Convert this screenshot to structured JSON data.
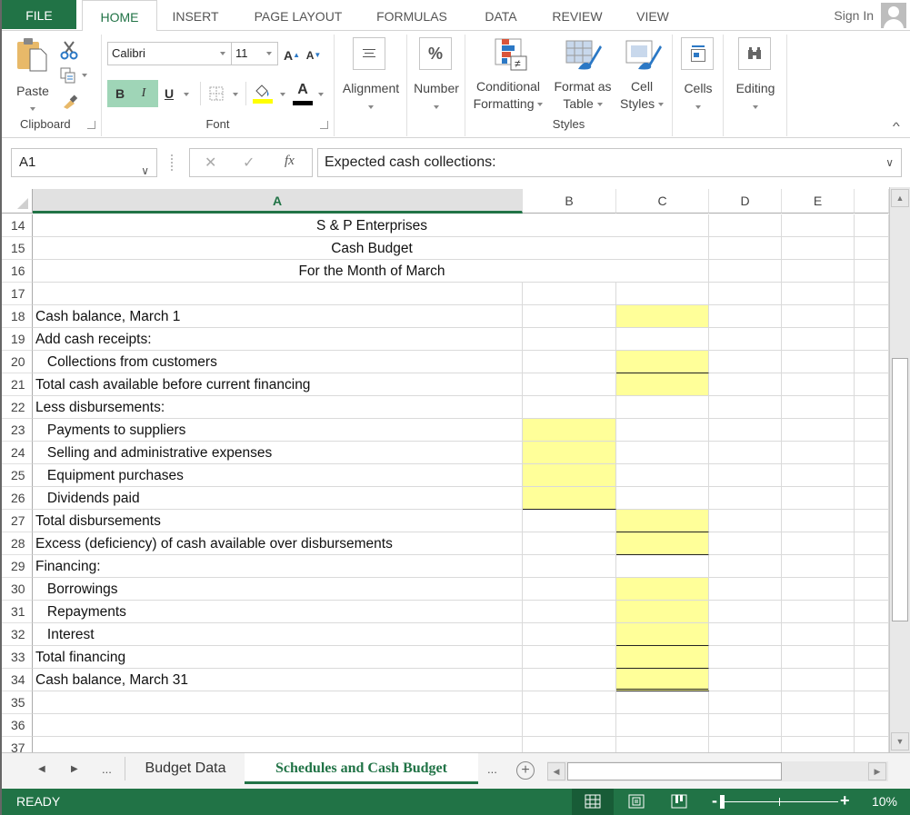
{
  "ribbon_tabs": [
    {
      "label": "FILE"
    },
    {
      "label": "HOME"
    },
    {
      "label": "INSERT"
    },
    {
      "label": "PAGE LAYOUT"
    },
    {
      "label": "FORMULAS"
    },
    {
      "label": "DATA"
    },
    {
      "label": "REVIEW"
    },
    {
      "label": "VIEW"
    }
  ],
  "active_tab": "HOME",
  "sign_in": "Sign In",
  "ribbon": {
    "clipboard": {
      "group_label": "Clipboard",
      "paste_label": "Paste"
    },
    "font": {
      "group_label": "Font",
      "font_name": "Calibri",
      "font_size": "11",
      "bold": "B",
      "italic": "I",
      "underline": "U",
      "grow": "A",
      "shrink": "A",
      "font_color": "A"
    },
    "alignment": {
      "label": "Alignment"
    },
    "number": {
      "label": "Number",
      "icon_text": "%"
    },
    "styles": {
      "group_label": "Styles",
      "conditional_1": "Conditional",
      "conditional_2": "Formatting",
      "format_table_1": "Format as",
      "format_table_2": "Table",
      "cell_styles_1": "Cell",
      "cell_styles_2": "Styles"
    },
    "cells": {
      "label": "Cells"
    },
    "editing": {
      "label": "Editing"
    }
  },
  "formula_bar": {
    "name_box": "A1",
    "cancel": "✕",
    "enter": "✓",
    "fx": "fx",
    "content": "Expected cash collections:"
  },
  "columns": [
    "A",
    "B",
    "C",
    "D",
    "E"
  ],
  "selected_column": "A",
  "rows": [
    {
      "num": "14",
      "a": "S & P Enterprises",
      "center": true
    },
    {
      "num": "15",
      "a": "Cash Budget",
      "center": true
    },
    {
      "num": "16",
      "a": "For the Month of March",
      "center": true
    },
    {
      "num": "17",
      "a": ""
    },
    {
      "num": "18",
      "a": "Cash balance, March 1"
    },
    {
      "num": "19",
      "a": "Add cash receipts:"
    },
    {
      "num": "20",
      "a": "   Collections from customers"
    },
    {
      "num": "21",
      "a": "Total cash available before current financing"
    },
    {
      "num": "22",
      "a": "Less disbursements:"
    },
    {
      "num": "23",
      "a": "   Payments to suppliers"
    },
    {
      "num": "24",
      "a": "   Selling and administrative expenses"
    },
    {
      "num": "25",
      "a": "   Equipment purchases"
    },
    {
      "num": "26",
      "a": "   Dividends paid"
    },
    {
      "num": "27",
      "a": "Total disbursements"
    },
    {
      "num": "28",
      "a": "Excess (deficiency) of cash available over disbursements"
    },
    {
      "num": "29",
      "a": "Financing:"
    },
    {
      "num": "30",
      "a": "   Borrowings"
    },
    {
      "num": "31",
      "a": "   Repayments"
    },
    {
      "num": "32",
      "a": "   Interest"
    },
    {
      "num": "33",
      "a": "Total financing"
    },
    {
      "num": "34",
      "a": "Cash balance, March 31"
    },
    {
      "num": "35",
      "a": ""
    },
    {
      "num": "36",
      "a": ""
    },
    {
      "num": "37",
      "a": ""
    }
  ],
  "input_cells": {
    "B": [
      "23",
      "24",
      "25",
      "26"
    ],
    "C": [
      "18",
      "20",
      "21",
      "27",
      "28",
      "30",
      "31",
      "32",
      "33",
      "34"
    ]
  },
  "input_fill_color": "#FFFF99",
  "sheet_tabs": {
    "nav_prev": "◀",
    "nav_next": "▶",
    "more_left": "...",
    "tabs": [
      {
        "label": "Budget Data"
      },
      {
        "label": "Schedules and Cash Budget"
      }
    ],
    "active": "Schedules and Cash Budget",
    "more_right": "...",
    "add": "+"
  },
  "status_bar": {
    "mode": "READY",
    "zoom_percent": "10%",
    "zoom_minus": "-",
    "zoom_plus": "+"
  },
  "theme": {
    "accent": "#217346"
  }
}
